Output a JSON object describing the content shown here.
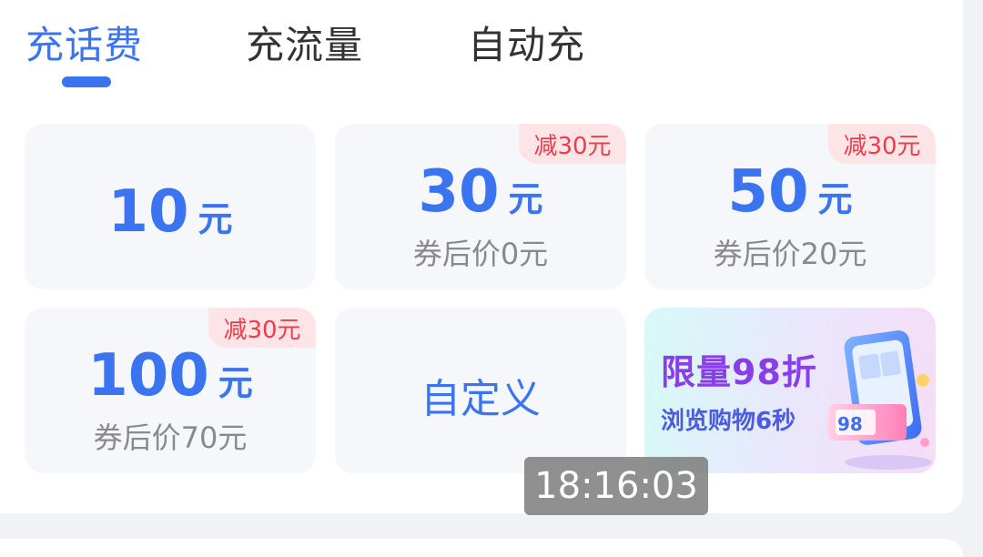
{
  "tabs": [
    {
      "label": "充话费",
      "active": true
    },
    {
      "label": "充流量",
      "active": false
    },
    {
      "label": "自动充",
      "active": false
    }
  ],
  "tiles": [
    {
      "amount": "10",
      "unit": "元",
      "badge": "",
      "sub": ""
    },
    {
      "amount": "30",
      "unit": "元",
      "badge": "减30元",
      "sub": "券后价0元"
    },
    {
      "amount": "50",
      "unit": "元",
      "badge": "减30元",
      "sub": "券后价20元"
    },
    {
      "amount": "100",
      "unit": "元",
      "badge": "减30元",
      "sub": "券后价70元"
    }
  ],
  "custom": {
    "label": "自定义"
  },
  "promo": {
    "title": "限量98折",
    "subtitle": "浏览购物6秒",
    "art_text": "98"
  },
  "overlay": {
    "timestamp": "18:16:03"
  },
  "colors": {
    "accent": "#3b74f0",
    "badge_text": "#ef3b4b",
    "badge_bg": "#fde4e6",
    "promo_title": "#8a3ee8"
  },
  "icons": {
    "promo_art": "phone-shopping-illustration"
  }
}
